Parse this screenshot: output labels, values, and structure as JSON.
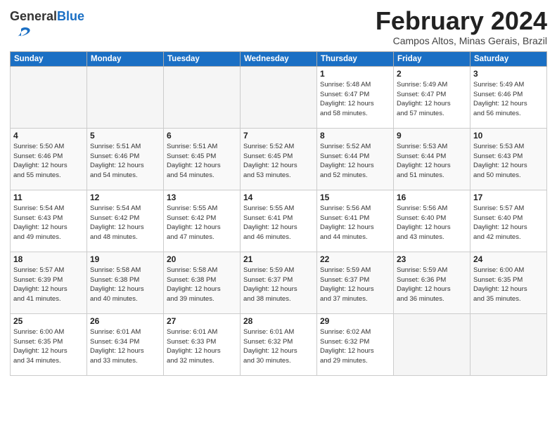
{
  "header": {
    "logo_general": "General",
    "logo_blue": "Blue",
    "month_title": "February 2024",
    "location": "Campos Altos, Minas Gerais, Brazil"
  },
  "weekdays": [
    "Sunday",
    "Monday",
    "Tuesday",
    "Wednesday",
    "Thursday",
    "Friday",
    "Saturday"
  ],
  "weeks": [
    [
      {
        "day": "",
        "info": ""
      },
      {
        "day": "",
        "info": ""
      },
      {
        "day": "",
        "info": ""
      },
      {
        "day": "",
        "info": ""
      },
      {
        "day": "1",
        "info": "Sunrise: 5:48 AM\nSunset: 6:47 PM\nDaylight: 12 hours\nand 58 minutes."
      },
      {
        "day": "2",
        "info": "Sunrise: 5:49 AM\nSunset: 6:47 PM\nDaylight: 12 hours\nand 57 minutes."
      },
      {
        "day": "3",
        "info": "Sunrise: 5:49 AM\nSunset: 6:46 PM\nDaylight: 12 hours\nand 56 minutes."
      }
    ],
    [
      {
        "day": "4",
        "info": "Sunrise: 5:50 AM\nSunset: 6:46 PM\nDaylight: 12 hours\nand 55 minutes."
      },
      {
        "day": "5",
        "info": "Sunrise: 5:51 AM\nSunset: 6:46 PM\nDaylight: 12 hours\nand 54 minutes."
      },
      {
        "day": "6",
        "info": "Sunrise: 5:51 AM\nSunset: 6:45 PM\nDaylight: 12 hours\nand 54 minutes."
      },
      {
        "day": "7",
        "info": "Sunrise: 5:52 AM\nSunset: 6:45 PM\nDaylight: 12 hours\nand 53 minutes."
      },
      {
        "day": "8",
        "info": "Sunrise: 5:52 AM\nSunset: 6:44 PM\nDaylight: 12 hours\nand 52 minutes."
      },
      {
        "day": "9",
        "info": "Sunrise: 5:53 AM\nSunset: 6:44 PM\nDaylight: 12 hours\nand 51 minutes."
      },
      {
        "day": "10",
        "info": "Sunrise: 5:53 AM\nSunset: 6:43 PM\nDaylight: 12 hours\nand 50 minutes."
      }
    ],
    [
      {
        "day": "11",
        "info": "Sunrise: 5:54 AM\nSunset: 6:43 PM\nDaylight: 12 hours\nand 49 minutes."
      },
      {
        "day": "12",
        "info": "Sunrise: 5:54 AM\nSunset: 6:42 PM\nDaylight: 12 hours\nand 48 minutes."
      },
      {
        "day": "13",
        "info": "Sunrise: 5:55 AM\nSunset: 6:42 PM\nDaylight: 12 hours\nand 47 minutes."
      },
      {
        "day": "14",
        "info": "Sunrise: 5:55 AM\nSunset: 6:41 PM\nDaylight: 12 hours\nand 46 minutes."
      },
      {
        "day": "15",
        "info": "Sunrise: 5:56 AM\nSunset: 6:41 PM\nDaylight: 12 hours\nand 44 minutes."
      },
      {
        "day": "16",
        "info": "Sunrise: 5:56 AM\nSunset: 6:40 PM\nDaylight: 12 hours\nand 43 minutes."
      },
      {
        "day": "17",
        "info": "Sunrise: 5:57 AM\nSunset: 6:40 PM\nDaylight: 12 hours\nand 42 minutes."
      }
    ],
    [
      {
        "day": "18",
        "info": "Sunrise: 5:57 AM\nSunset: 6:39 PM\nDaylight: 12 hours\nand 41 minutes."
      },
      {
        "day": "19",
        "info": "Sunrise: 5:58 AM\nSunset: 6:38 PM\nDaylight: 12 hours\nand 40 minutes."
      },
      {
        "day": "20",
        "info": "Sunrise: 5:58 AM\nSunset: 6:38 PM\nDaylight: 12 hours\nand 39 minutes."
      },
      {
        "day": "21",
        "info": "Sunrise: 5:59 AM\nSunset: 6:37 PM\nDaylight: 12 hours\nand 38 minutes."
      },
      {
        "day": "22",
        "info": "Sunrise: 5:59 AM\nSunset: 6:37 PM\nDaylight: 12 hours\nand 37 minutes."
      },
      {
        "day": "23",
        "info": "Sunrise: 5:59 AM\nSunset: 6:36 PM\nDaylight: 12 hours\nand 36 minutes."
      },
      {
        "day": "24",
        "info": "Sunrise: 6:00 AM\nSunset: 6:35 PM\nDaylight: 12 hours\nand 35 minutes."
      }
    ],
    [
      {
        "day": "25",
        "info": "Sunrise: 6:00 AM\nSunset: 6:35 PM\nDaylight: 12 hours\nand 34 minutes."
      },
      {
        "day": "26",
        "info": "Sunrise: 6:01 AM\nSunset: 6:34 PM\nDaylight: 12 hours\nand 33 minutes."
      },
      {
        "day": "27",
        "info": "Sunrise: 6:01 AM\nSunset: 6:33 PM\nDaylight: 12 hours\nand 32 minutes."
      },
      {
        "day": "28",
        "info": "Sunrise: 6:01 AM\nSunset: 6:32 PM\nDaylight: 12 hours\nand 30 minutes."
      },
      {
        "day": "29",
        "info": "Sunrise: 6:02 AM\nSunset: 6:32 PM\nDaylight: 12 hours\nand 29 minutes."
      },
      {
        "day": "",
        "info": ""
      },
      {
        "day": "",
        "info": ""
      }
    ]
  ]
}
